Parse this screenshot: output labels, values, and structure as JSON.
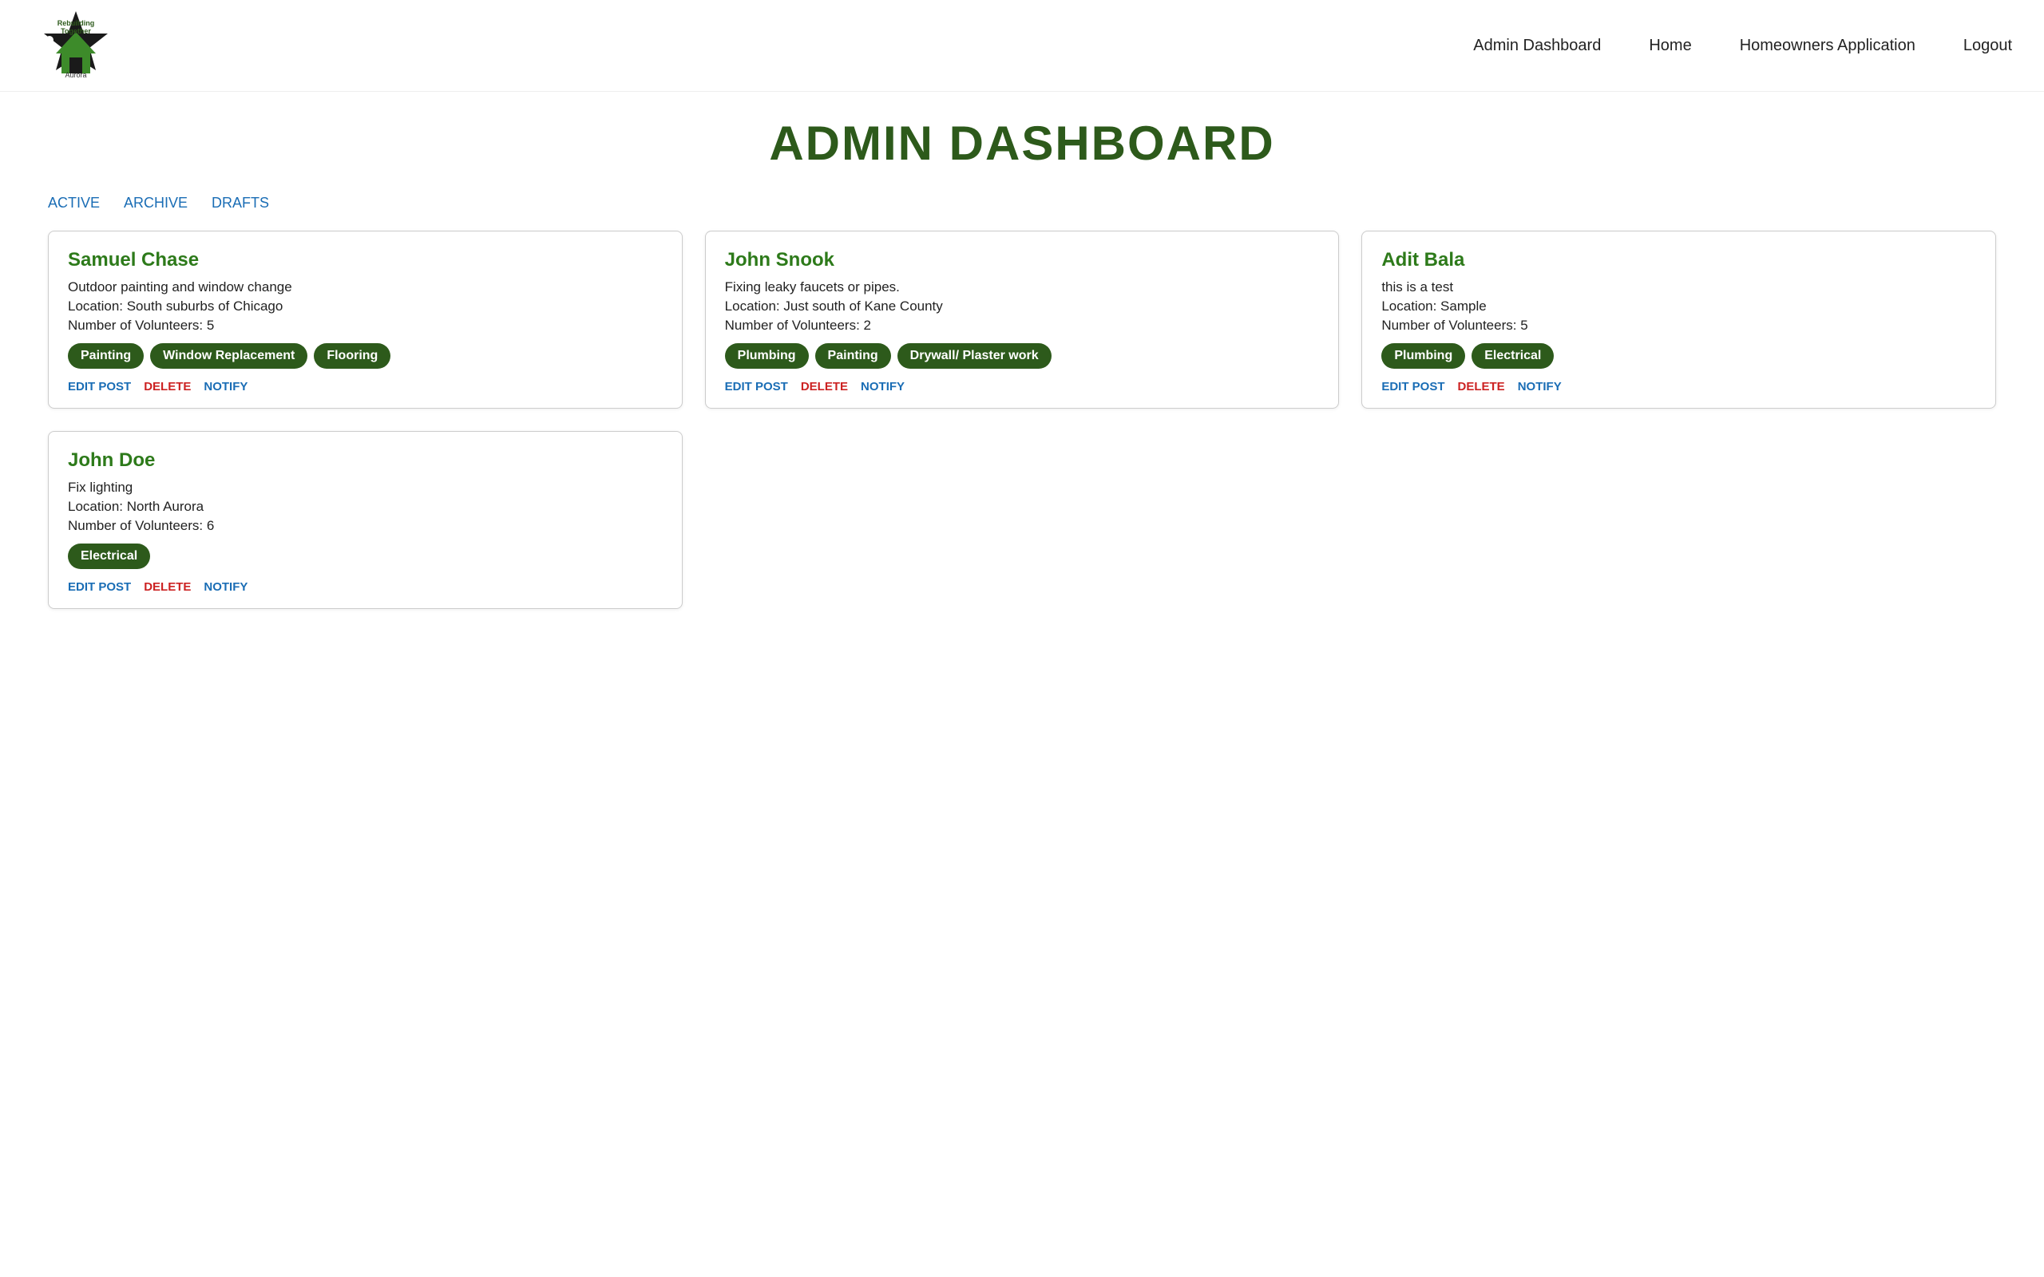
{
  "nav": {
    "logo_text": "Aurora",
    "links": [
      {
        "label": "Admin Dashboard",
        "name": "nav-admin-dashboard"
      },
      {
        "label": "Home",
        "name": "nav-home"
      },
      {
        "label": "Homeowners Application",
        "name": "nav-homeowners"
      },
      {
        "label": "Logout",
        "name": "nav-logout"
      }
    ]
  },
  "page": {
    "title": "ADMIN DASHBOARD"
  },
  "tabs": [
    {
      "label": "ACTIVE",
      "name": "tab-active"
    },
    {
      "label": "ARCHIVE",
      "name": "tab-archive"
    },
    {
      "label": "DRAFTS",
      "name": "tab-drafts"
    }
  ],
  "cards": [
    {
      "name": "Samuel Chase",
      "description": "Outdoor painting and window change",
      "location": "Location: South suburbs of Chicago",
      "volunteers": "Number of Volunteers: 5",
      "tags": [
        "Painting",
        "Window Replacement",
        "Flooring"
      ],
      "actions": {
        "edit": "EDIT POST",
        "delete": "DELETE",
        "notify": "NOTIFY"
      }
    },
    {
      "name": "John Snook",
      "description": "Fixing leaky faucets or pipes.",
      "location": "Location: Just south of Kane County",
      "volunteers": "Number of Volunteers: 2",
      "tags": [
        "Plumbing",
        "Painting",
        "Drywall/ Plaster work"
      ],
      "actions": {
        "edit": "EDIT POST",
        "delete": "DELETE",
        "notify": "NOTIFY"
      }
    },
    {
      "name": "Adit Bala",
      "description": "this is a test",
      "location": "Location: Sample",
      "volunteers": "Number of Volunteers: 5",
      "tags": [
        "Plumbing",
        "Electrical"
      ],
      "actions": {
        "edit": "EDIT POST",
        "delete": "DELETE",
        "notify": "NOTIFY"
      }
    },
    {
      "name": "John Doe",
      "description": "Fix lighting",
      "location": "Location: North Aurora",
      "volunteers": "Number of Volunteers: 6",
      "tags": [
        "Electrical"
      ],
      "actions": {
        "edit": "EDIT POST",
        "delete": "DELETE",
        "notify": "NOTIFY"
      }
    }
  ]
}
